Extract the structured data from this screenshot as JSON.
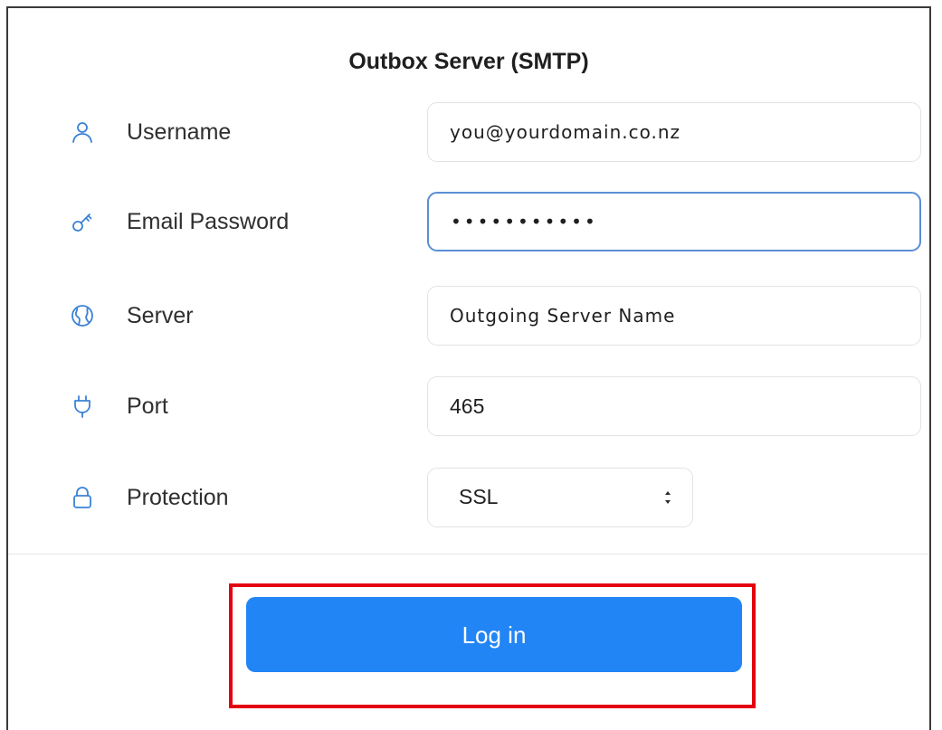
{
  "title": "Outbox Server (SMTP)",
  "fields": {
    "username": {
      "label": "Username",
      "value": "you@yourdomain.co.nz",
      "icon": "user-icon"
    },
    "password": {
      "label": "Email Password",
      "value": "•••••••••••",
      "icon": "key-icon"
    },
    "server": {
      "label": "Server",
      "value": "Outgoing Server Name",
      "icon": "globe-icon"
    },
    "port": {
      "label": "Port",
      "value": "465",
      "icon": "plug-icon"
    },
    "protection": {
      "label": "Protection",
      "value": "SSL",
      "icon": "lock-icon"
    }
  },
  "login_label": "Log in",
  "colors": {
    "accent": "#2285F5",
    "icon": "#3B82D6",
    "focus_border": "#5A8ED3",
    "highlight": "#E4000F"
  }
}
